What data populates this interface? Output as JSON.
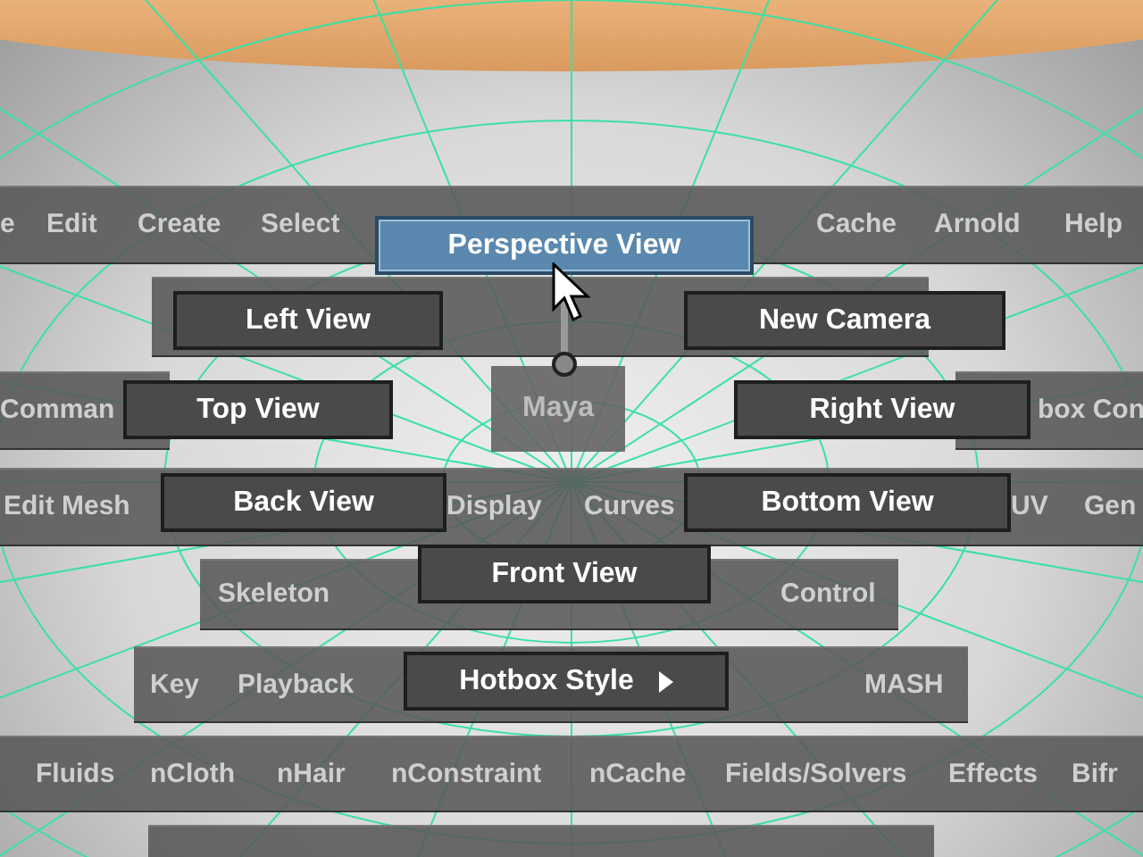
{
  "menu_rows": [
    {
      "items": [
        "e",
        "Edit",
        "Create",
        "Select",
        "Cache",
        "Arnold",
        "Help"
      ]
    },
    {
      "items": []
    },
    {
      "items": [
        "Comman",
        "box Con"
      ]
    },
    {
      "items": [
        "Edit Mesh",
        "Display",
        "Curves",
        "UV",
        "Gen"
      ]
    },
    {
      "items": [
        "Skeleton",
        "Control"
      ]
    },
    {
      "items": [
        "Key",
        "Playback",
        "MASH"
      ]
    },
    {
      "items": [
        "Fluids",
        "nCloth",
        "nHair",
        "nConstraint",
        "nCache",
        "Fields/Solvers",
        "Effects",
        "Bifr"
      ]
    },
    {
      "items": []
    }
  ],
  "center": {
    "label": "Maya"
  },
  "marking_menu": [
    {
      "label": "Perspective View",
      "selected": true,
      "kind": "item"
    },
    {
      "label": "Left View",
      "selected": false,
      "kind": "item"
    },
    {
      "label": "New Camera",
      "selected": false,
      "kind": "item"
    },
    {
      "label": "Top View",
      "selected": false,
      "kind": "item"
    },
    {
      "label": "Right View",
      "selected": false,
      "kind": "item"
    },
    {
      "label": "Back View",
      "selected": false,
      "kind": "item"
    },
    {
      "label": "Bottom View",
      "selected": false,
      "kind": "item"
    },
    {
      "label": "Front View",
      "selected": false,
      "kind": "item"
    },
    {
      "label": "Hotbox Style",
      "selected": false,
      "kind": "submenu"
    }
  ]
}
